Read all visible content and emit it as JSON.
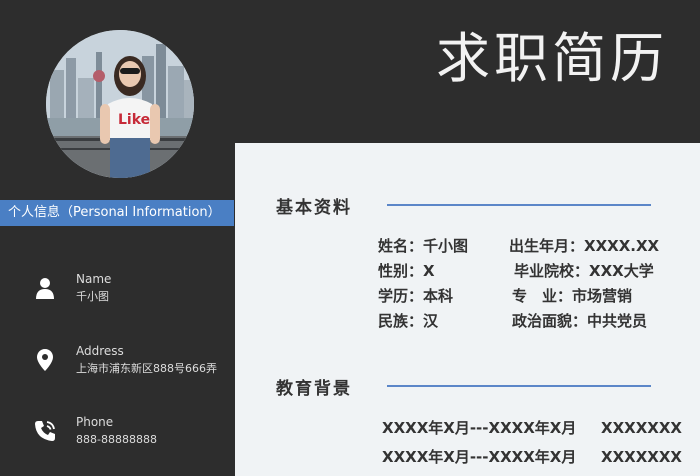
{
  "header": {
    "title": "求职简历"
  },
  "sidebar": {
    "section_label": "个人信息（Personal Information）",
    "contacts": [
      {
        "label": "Name",
        "value": "千小图",
        "icon": "person-icon"
      },
      {
        "label": "Address",
        "value": "上海市浦东新区888号666弄",
        "icon": "location-pin-icon"
      },
      {
        "label": "Phone",
        "value": "888-88888888",
        "icon": "phone-icon"
      }
    ]
  },
  "basic_info": {
    "heading": "基本资料",
    "rows": [
      {
        "left": "姓名：千小图",
        "right": "出生年月：XXXX.XX"
      },
      {
        "left": "性别：X",
        "right": "毕业院校：XXX大学"
      },
      {
        "left": "学历：本科",
        "right": "专　业：市场营销"
      },
      {
        "left": "民族：汉",
        "right": "政治面貌：中共党员"
      }
    ]
  },
  "education": {
    "heading": "教育背景",
    "rows": [
      {
        "period": "XXXX年X月---XXXX年X月",
        "school": "XXXXXXX"
      },
      {
        "period": "XXXX年X月---XXXX年X月",
        "school": "XXXXXXX"
      }
    ]
  },
  "colors": {
    "background": "#2d2d2d",
    "accent": "#4a7fc4",
    "panel": "#f0f3f5",
    "text_dark": "#333333",
    "text_light": "#dcdcdc"
  }
}
